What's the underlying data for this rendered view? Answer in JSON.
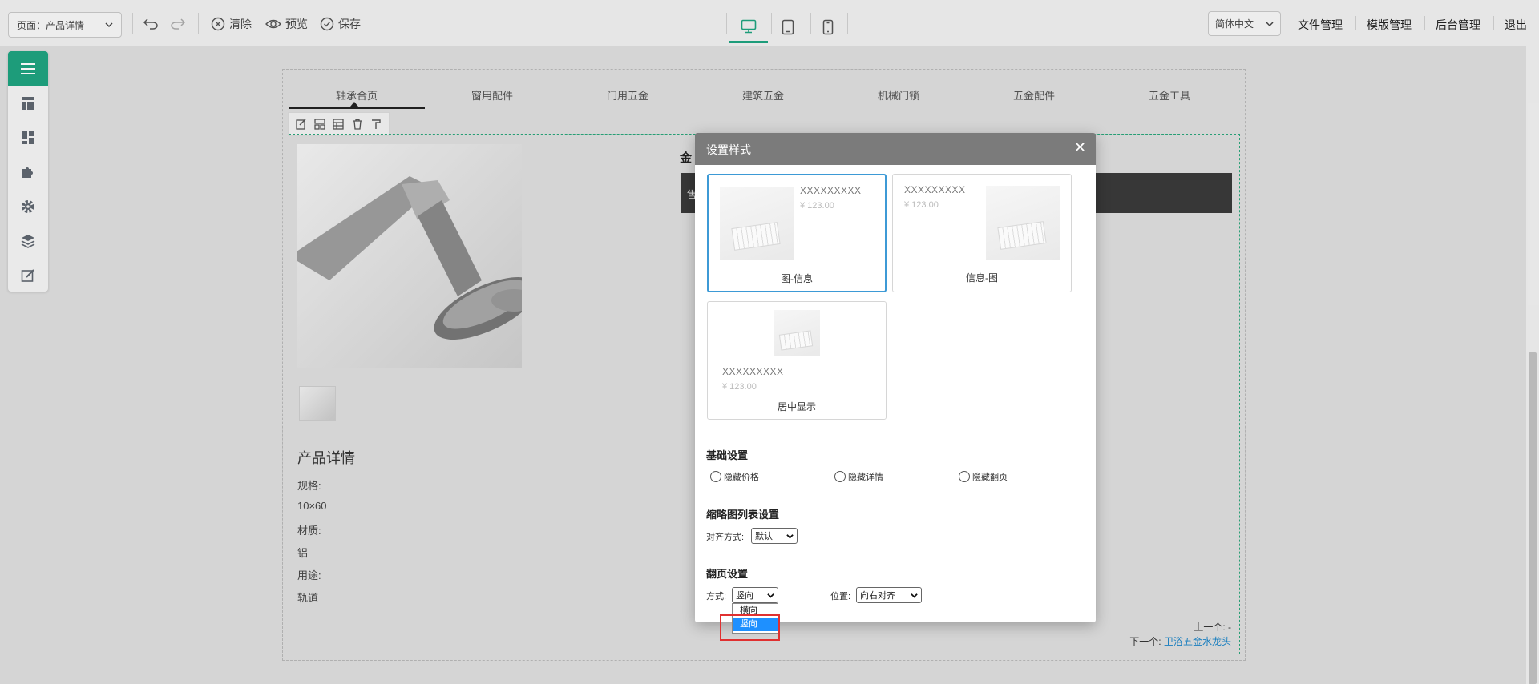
{
  "toolbar": {
    "page_select": "页面：产品详情",
    "clear_label": "清除",
    "preview_label": "预览",
    "save_label": "保存"
  },
  "lang": "简体中文",
  "menu": [
    "文件管理",
    "模版管理",
    "后台管理",
    "退出"
  ],
  "nav": [
    "轴承合页",
    "窗用配件",
    "门用五金",
    "建筑五金",
    "机械门锁",
    "五金配件",
    "五金工具"
  ],
  "product": {
    "title_partial": "金",
    "strip_partial": "售",
    "detail_title": "产品详情",
    "specs": [
      "规格:",
      "10×60",
      "材质:",
      "铝",
      "用途:",
      "轨道"
    ],
    "prev_label": "上一个: -",
    "next_label": "下一个:",
    "next_link": "卫浴五金水龙头"
  },
  "dialog": {
    "title": "设置样式",
    "close": "✕",
    "styles": [
      {
        "name": "XXXXXXXXX",
        "price": "¥ 123.00",
        "caption": "图-信息",
        "selected": true
      },
      {
        "name": "XXXXXXXXX",
        "price": "¥ 123.00",
        "caption": "信息-图",
        "selected": false
      },
      {
        "name": "XXXXXXXXX",
        "price": "¥ 123.00",
        "caption": "居中显示",
        "selected": false
      }
    ],
    "basic_title": "基础设置",
    "basic_options": [
      "隐藏价格",
      "隐藏详情",
      "隐藏翻页"
    ],
    "thumb_title": "缩略图列表设置",
    "align_label": "对齐方式:",
    "align_value": "默认",
    "page_title": "翻页设置",
    "mode_label": "方式:",
    "mode_value": "竖向",
    "position_label": "位置:",
    "position_value": "向右对齐",
    "mode_options": [
      "横向",
      "竖向"
    ]
  },
  "colors": {
    "accent": "#1fa37f",
    "dialog_head": "#7b7b7b",
    "selected_border": "#3d9ad6",
    "highlight": "#1e90ff",
    "annotation": "#e03030"
  }
}
